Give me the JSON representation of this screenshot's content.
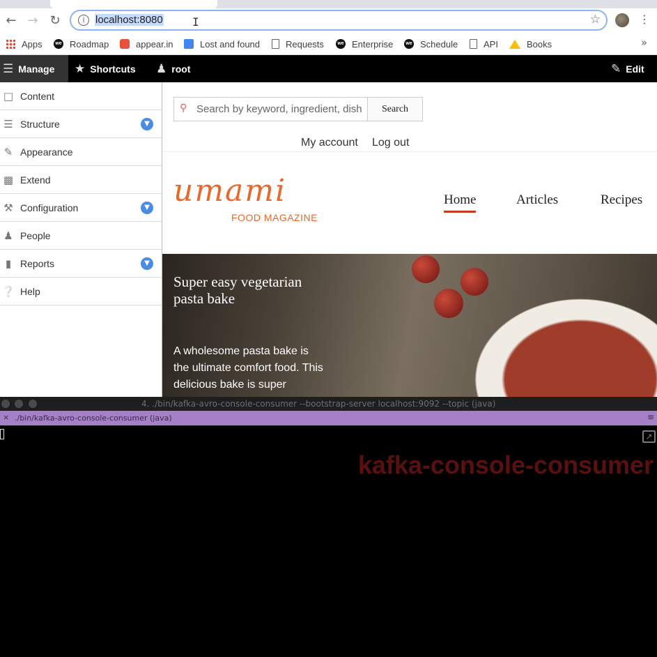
{
  "browser": {
    "url": "localhost:8080",
    "bookmarks": [
      "Apps",
      "Roadmap",
      "appear.in",
      "Lost and found",
      "Requests",
      "Enterprise",
      "Schedule",
      "API",
      "Books"
    ],
    "icons": {
      "back": "back-arrow-icon",
      "forward": "forward-arrow-icon",
      "reload": "reload-icon",
      "info": "info-icon",
      "star": "star-icon",
      "more": "kebab-menu-icon",
      "overflow": "chevron-double-right-icon"
    }
  },
  "drupal_toolbar": {
    "manage": "Manage",
    "shortcuts": "Shortcuts",
    "user": "root",
    "edit": "Edit"
  },
  "admin_menu": {
    "items": [
      {
        "label": "Content",
        "icon": "document-icon",
        "expandable": false
      },
      {
        "label": "Structure",
        "icon": "sitemap-icon",
        "expandable": true
      },
      {
        "label": "Appearance",
        "icon": "paintbrush-icon",
        "expandable": false
      },
      {
        "label": "Extend",
        "icon": "puzzle-icon",
        "expandable": false
      },
      {
        "label": "Configuration",
        "icon": "wrench-icon",
        "expandable": true
      },
      {
        "label": "People",
        "icon": "people-icon",
        "expandable": false
      },
      {
        "label": "Reports",
        "icon": "bar-chart-icon",
        "expandable": true
      },
      {
        "label": "Help",
        "icon": "help-icon",
        "expandable": false
      }
    ]
  },
  "site": {
    "search": {
      "placeholder": "Search by keyword, ingredient, dish",
      "button": "Search"
    },
    "account_links": [
      "My account",
      "Log out"
    ],
    "logo": "umami",
    "tagline": "FOOD MAGAZINE",
    "nav": [
      "Home",
      "Articles",
      "Recipes"
    ],
    "active_nav": "Home",
    "hero": {
      "title": "Super easy vegetarian pasta bake",
      "text": "A wholesome pasta bake is the ultimate comfort food. This delicious bake is super"
    }
  },
  "terminal": {
    "window_title": "4. ./bin/kafka-avro-console-consumer --bootstrap-server localhost:9092 --topic   (java)",
    "tab_title": "./bin/kafka-avro-console-consumer (java)",
    "overlay_label": "kafka-console-consumer"
  },
  "colors": {
    "brand": "#e8692c",
    "nav_underline": "#c93a1a",
    "toggle": "#4a8ce3",
    "terminal_tab": "#a57fc8",
    "overlay": "#5a1010"
  }
}
